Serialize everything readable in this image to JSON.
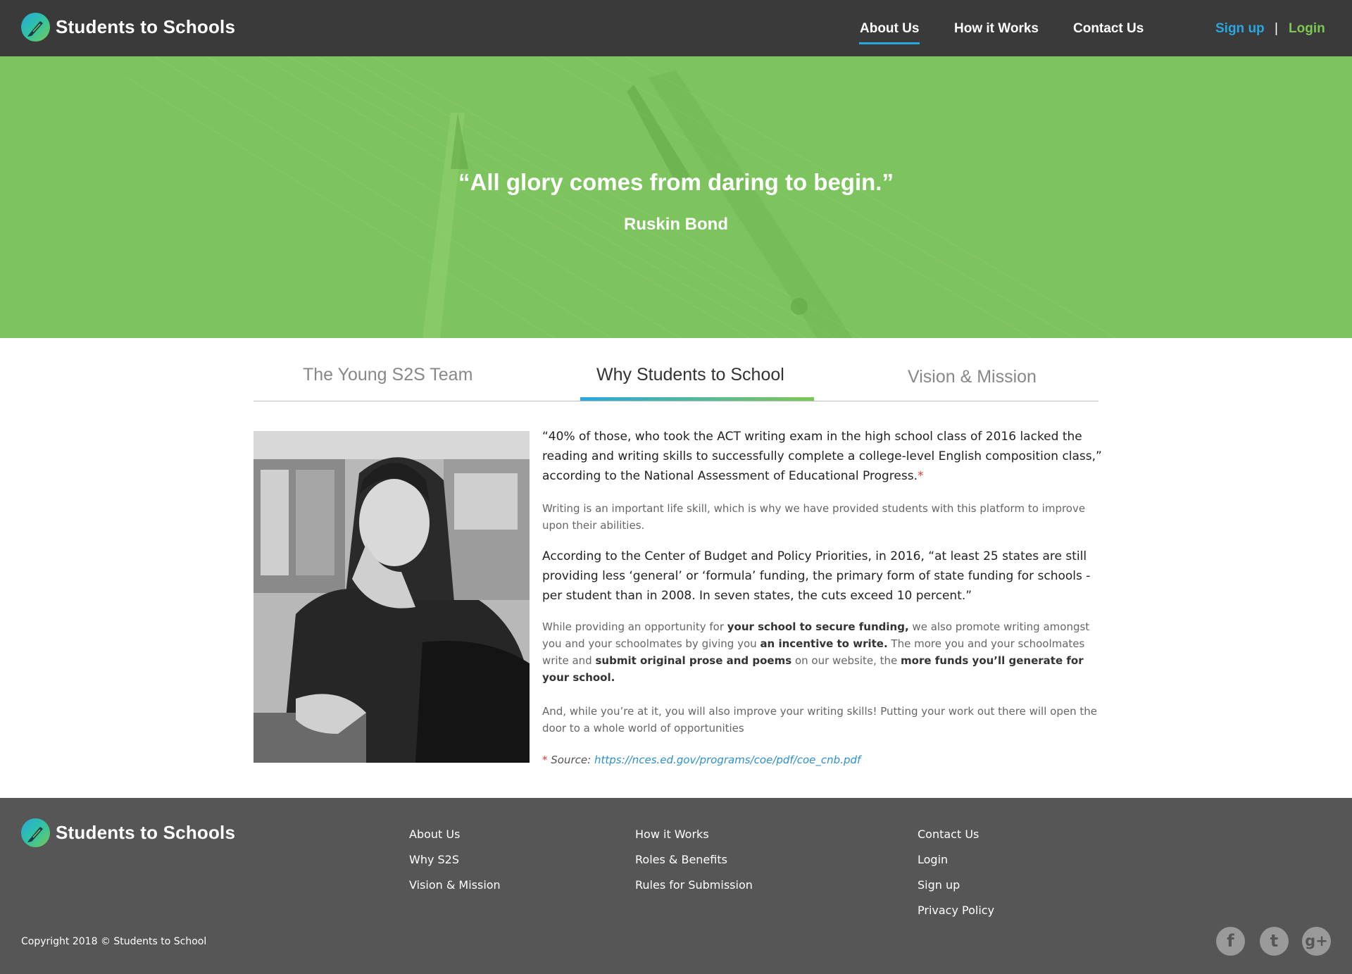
{
  "header": {
    "brand": "Students to Schools",
    "nav": [
      "About Us",
      "How it Works",
      "Contact Us"
    ],
    "active_nav": "About Us",
    "signup": "Sign up",
    "separator": "|",
    "login": "Login"
  },
  "hero": {
    "quote": "“All glory comes from daring to begin.”",
    "author": "Ruskin Bond"
  },
  "tabs": {
    "items": [
      "The Young S2S Team",
      "Why Students to School",
      "Vision & Mission"
    ],
    "active": "Why Students to School"
  },
  "content": {
    "lead1_text": "“40% of those, who took the ACT writing exam in the high school class of 2016 lacked the reading and writing skills to successfully complete a college-level English composition class,” according to the National Assessment of Educational Progress.",
    "lead1_mark": "*",
    "p1": "Writing is an important life skill, which is why we have provided students with this platform to improve upon their abilities.",
    "lead2": "According to the Center of Budget and Policy Priorities, in 2016, “at least 25 states are still providing less ‘general’ or ‘formula’ funding, the primary form of state funding for schools - per student than in 2008.  In seven states, the cuts exceed 10 percent.”",
    "p2": {
      "t1": "While providing an opportunity for ",
      "b1": "your school to secure funding,",
      "t2": " we also promote writing amongst you and your schoolmates by giving you ",
      "b2": "an incentive to write.",
      "t3": " The more you and your schoolmates write and ",
      "b3": "submit original prose and poems",
      "t4": " on our website, the ",
      "b4": "more funds you’ll generate for your school."
    },
    "p3": "And, while you’re at it, you will also improve your writing skills! Putting your work out there will open the door to a whole world of opportunities",
    "source_mark": "*",
    "source_label": "Source:",
    "source_url": "https://nces.ed.gov/programs/coe/pdf/coe_cnb.pdf"
  },
  "footer": {
    "brand": "Students to Schools",
    "col1": [
      "About Us",
      "Why S2S",
      "Vision & Mission"
    ],
    "col2": [
      "How it Works",
      "Roles & Benefits",
      "Rules for Submission"
    ],
    "col3": [
      "Contact Us",
      "Login",
      "Sign up",
      "Privacy Policy"
    ],
    "copyright": "Copyright 2018 ©  Students to School",
    "social": [
      {
        "icon": "facebook-icon",
        "glyph": "f"
      },
      {
        "icon": "twitter-icon",
        "glyph": "t"
      },
      {
        "icon": "google-plus-icon",
        "glyph": "g+"
      }
    ]
  },
  "colors": {
    "header_bg": "#3a3a3a",
    "hero_green": "#7dc45e",
    "accent_blue": "#29a8df",
    "accent_green": "#7dc855",
    "footer_bg": "#565656"
  }
}
